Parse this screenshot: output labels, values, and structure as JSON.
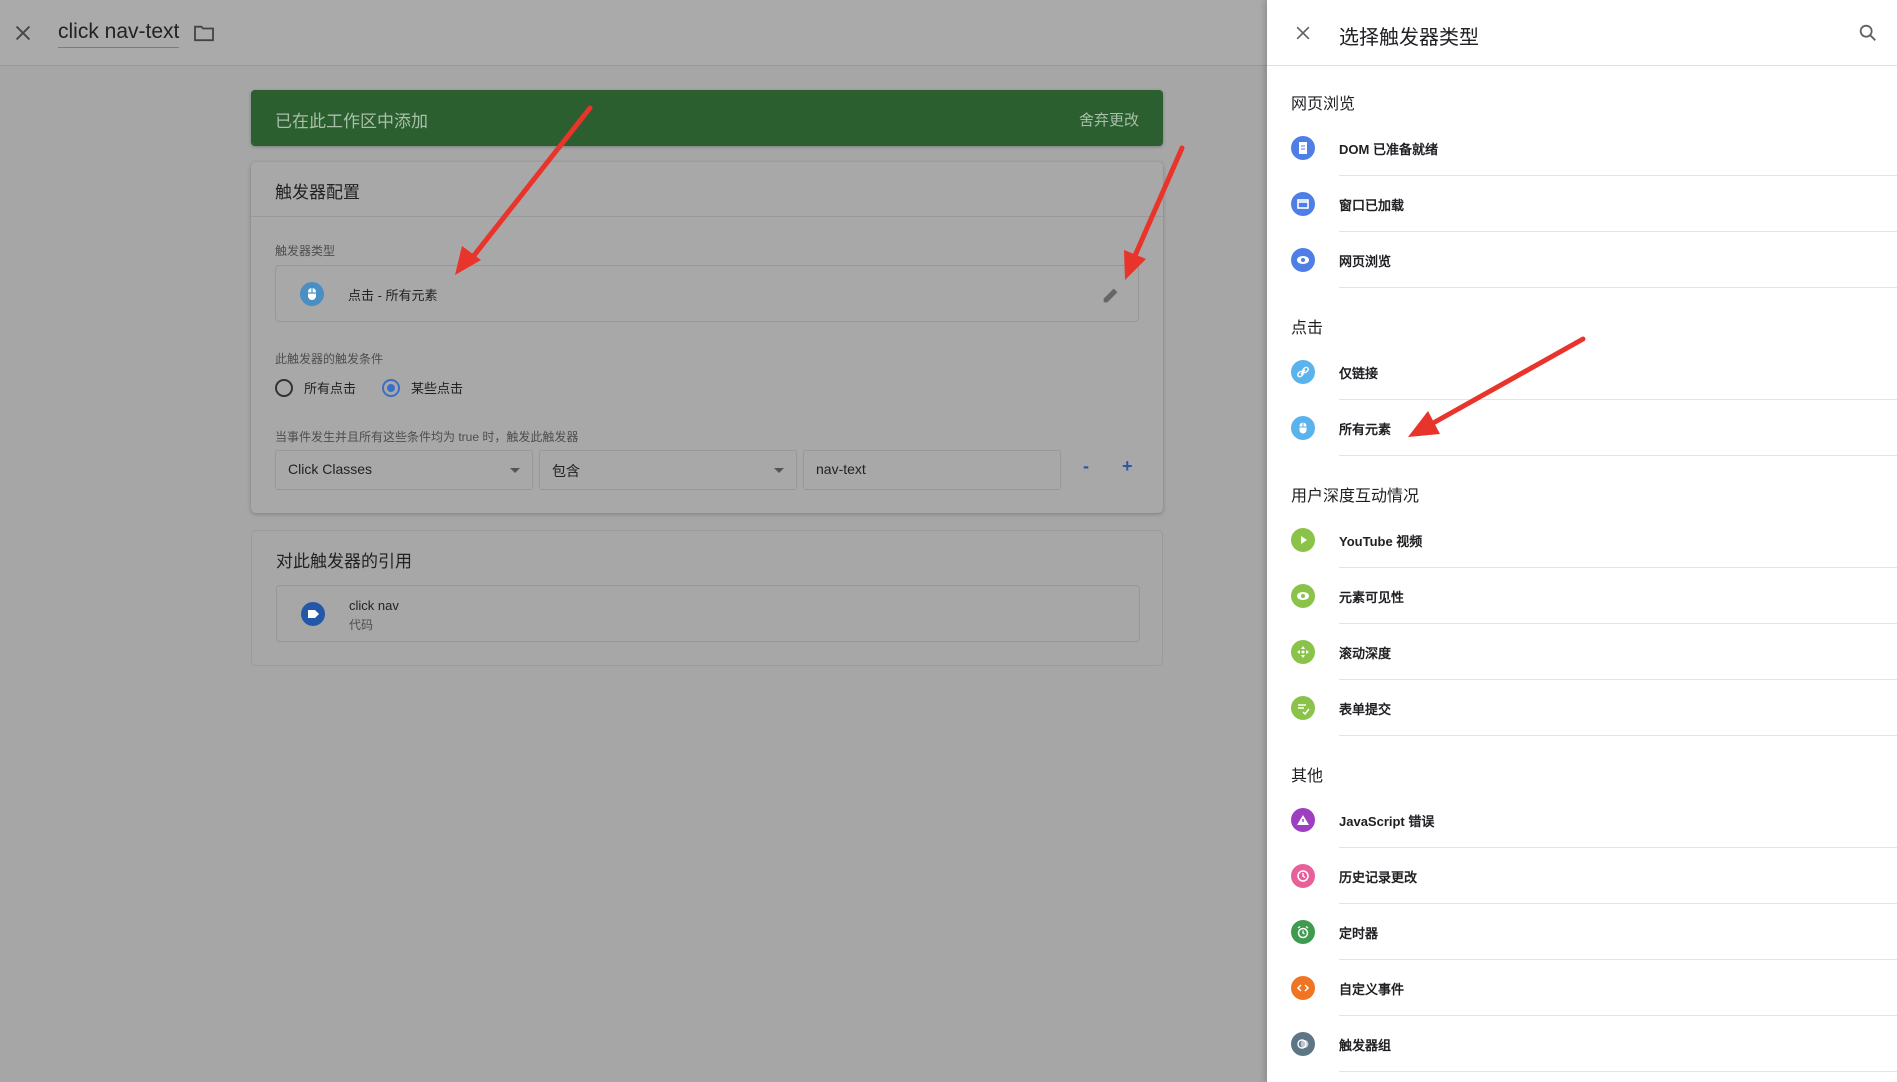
{
  "editor": {
    "title": "click nav-text",
    "banner_message": "已在此工作区中添加",
    "banner_action": "舍弃更改",
    "config_heading": "触发器配置",
    "trigger_type_label": "触发器类型",
    "trigger_type_value": "点击 - 所有元素",
    "fires_on_label": "此触发器的触发条件",
    "radio_all": "所有点击",
    "radio_some": "某些点击",
    "condition_label": "当事件发生并且所有这些条件均为 true 时，触发此触发器",
    "condition_variable": "Click Classes",
    "condition_operator": "包含",
    "condition_value": "nav-text",
    "minus_label": "-",
    "plus_label": "+",
    "refs_heading": "对此触发器的引用",
    "ref_name": "click nav",
    "ref_type": "代码"
  },
  "panel": {
    "title": "选择触发器类型",
    "sections": [
      {
        "title": "网页浏览",
        "items": [
          {
            "label": "DOM 已准备就绪",
            "icon": "document-icon",
            "color": "#4e7ee6"
          },
          {
            "label": "窗口已加载",
            "icon": "window-icon",
            "color": "#4e7ee6"
          },
          {
            "label": "网页浏览",
            "icon": "eye-icon",
            "color": "#4e7ee6"
          }
        ]
      },
      {
        "title": "点击",
        "items": [
          {
            "label": "仅链接",
            "icon": "link-icon",
            "color": "#5ab3ec"
          },
          {
            "label": "所有元素",
            "icon": "mouse-icon",
            "color": "#5ab3ec"
          }
        ]
      },
      {
        "title": "用户深度互动情况",
        "items": [
          {
            "label": "YouTube 视频",
            "icon": "play-icon",
            "color": "#8bc34a"
          },
          {
            "label": "元素可见性",
            "icon": "eye-icon",
            "color": "#8bc34a"
          },
          {
            "label": "滚动深度",
            "icon": "move-icon",
            "color": "#8bc34a"
          },
          {
            "label": "表单提交",
            "icon": "form-icon",
            "color": "#8bc34a"
          }
        ]
      },
      {
        "title": "其他",
        "items": [
          {
            "label": "JavaScript 错误",
            "icon": "warning-icon",
            "color": "#9c3fc1"
          },
          {
            "label": "历史记录更改",
            "icon": "history-icon",
            "color": "#e7609a"
          },
          {
            "label": "定时器",
            "icon": "timer-icon",
            "color": "#3e9b50"
          },
          {
            "label": "自定义事件",
            "icon": "code-icon",
            "color": "#f07522"
          },
          {
            "label": "触发器组",
            "icon": "group-icon",
            "color": "#5e7585"
          }
        ]
      }
    ]
  }
}
